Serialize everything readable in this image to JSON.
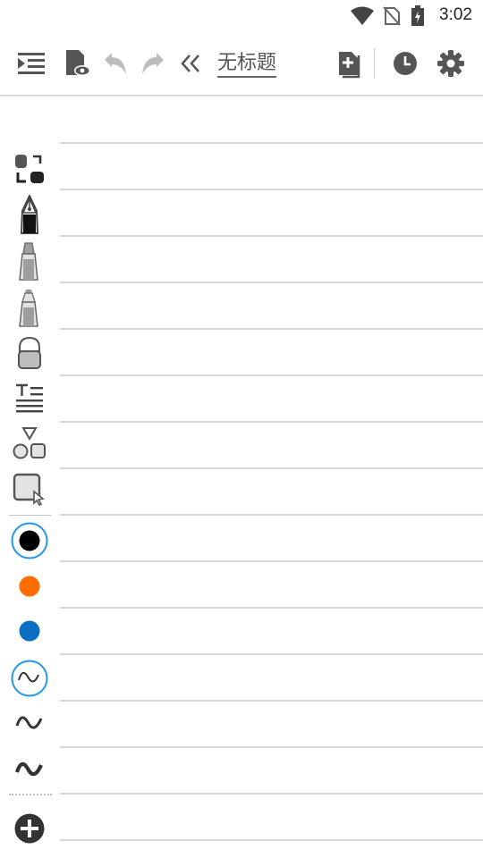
{
  "status_bar": {
    "time": "3:02"
  },
  "toolbar": {
    "title": "无标题"
  },
  "sidebar": {
    "tools": [
      "lasso-select",
      "fountain-pen",
      "marker",
      "highlighter",
      "eraser",
      "text",
      "shapes",
      "image-select"
    ],
    "colors": [
      "#000000",
      "#ff6d00",
      "#0a6fc2"
    ],
    "selected_color": "#000000",
    "stroke_widths": [
      "thin",
      "medium",
      "thick"
    ],
    "selected_stroke": "thin"
  },
  "colors": {
    "accent": "#2196f3",
    "icon": "#555555",
    "disabled_icon": "#bdbdbd"
  }
}
